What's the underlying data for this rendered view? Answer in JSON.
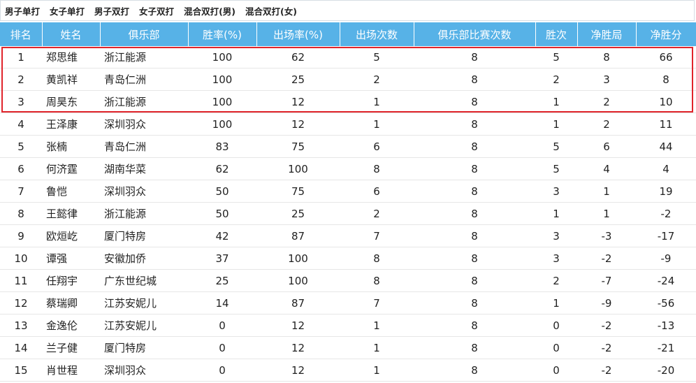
{
  "tabs": [
    "男子单打",
    "女子单打",
    "男子双打",
    "女子双打",
    "混合双打(男)",
    "混合双打(女)"
  ],
  "headers": [
    "排名",
    "姓名",
    "俱乐部",
    "胜率(%)",
    "出场率(%)",
    "出场次数",
    "俱乐部比赛次数",
    "胜次",
    "净胜局",
    "净胜分"
  ],
  "colors": {
    "header_bg": "#57b2e7",
    "highlight_border": "#e0242b"
  },
  "rows": [
    {
      "rank": "1",
      "name": "郑思维",
      "club": "浙江能源",
      "win_rate": "100",
      "appear_rate": "62",
      "appearances": "5",
      "club_matches": "8",
      "wins": "5",
      "net_games": "8",
      "net_points": "66"
    },
    {
      "rank": "2",
      "name": "黄凯祥",
      "club": "青岛仁洲",
      "win_rate": "100",
      "appear_rate": "25",
      "appearances": "2",
      "club_matches": "8",
      "wins": "2",
      "net_games": "3",
      "net_points": "8"
    },
    {
      "rank": "3",
      "name": "周昊东",
      "club": "浙江能源",
      "win_rate": "100",
      "appear_rate": "12",
      "appearances": "1",
      "club_matches": "8",
      "wins": "1",
      "net_games": "2",
      "net_points": "10"
    },
    {
      "rank": "4",
      "name": "王泽康",
      "club": "深圳羽众",
      "win_rate": "100",
      "appear_rate": "12",
      "appearances": "1",
      "club_matches": "8",
      "wins": "1",
      "net_games": "2",
      "net_points": "11"
    },
    {
      "rank": "5",
      "name": "张楠",
      "club": "青岛仁洲",
      "win_rate": "83",
      "appear_rate": "75",
      "appearances": "6",
      "club_matches": "8",
      "wins": "5",
      "net_games": "6",
      "net_points": "44"
    },
    {
      "rank": "6",
      "name": "何济霆",
      "club": "湖南华菜",
      "win_rate": "62",
      "appear_rate": "100",
      "appearances": "8",
      "club_matches": "8",
      "wins": "5",
      "net_games": "4",
      "net_points": "4"
    },
    {
      "rank": "7",
      "name": "鲁恺",
      "club": "深圳羽众",
      "win_rate": "50",
      "appear_rate": "75",
      "appearances": "6",
      "club_matches": "8",
      "wins": "3",
      "net_games": "1",
      "net_points": "19"
    },
    {
      "rank": "8",
      "name": "王懿律",
      "club": "浙江能源",
      "win_rate": "50",
      "appear_rate": "25",
      "appearances": "2",
      "club_matches": "8",
      "wins": "1",
      "net_games": "1",
      "net_points": "-2"
    },
    {
      "rank": "9",
      "name": "欧烜屹",
      "club": "厦门特房",
      "win_rate": "42",
      "appear_rate": "87",
      "appearances": "7",
      "club_matches": "8",
      "wins": "3",
      "net_games": "-3",
      "net_points": "-17"
    },
    {
      "rank": "10",
      "name": "谭强",
      "club": "安徽加侨",
      "win_rate": "37",
      "appear_rate": "100",
      "appearances": "8",
      "club_matches": "8",
      "wins": "3",
      "net_games": "-2",
      "net_points": "-9"
    },
    {
      "rank": "11",
      "name": "任翔宇",
      "club": "广东世纪城",
      "win_rate": "25",
      "appear_rate": "100",
      "appearances": "8",
      "club_matches": "8",
      "wins": "2",
      "net_games": "-7",
      "net_points": "-24"
    },
    {
      "rank": "12",
      "name": "蔡瑞卿",
      "club": "江苏安妮儿",
      "win_rate": "14",
      "appear_rate": "87",
      "appearances": "7",
      "club_matches": "8",
      "wins": "1",
      "net_games": "-9",
      "net_points": "-56"
    },
    {
      "rank": "13",
      "name": "金逸伦",
      "club": "江苏安妮儿",
      "win_rate": "0",
      "appear_rate": "12",
      "appearances": "1",
      "club_matches": "8",
      "wins": "0",
      "net_games": "-2",
      "net_points": "-13"
    },
    {
      "rank": "14",
      "name": "兰子健",
      "club": "厦门特房",
      "win_rate": "0",
      "appear_rate": "12",
      "appearances": "1",
      "club_matches": "8",
      "wins": "0",
      "net_games": "-2",
      "net_points": "-21"
    },
    {
      "rank": "15",
      "name": "肖世程",
      "club": "深圳羽众",
      "win_rate": "0",
      "appear_rate": "12",
      "appearances": "1",
      "club_matches": "8",
      "wins": "0",
      "net_games": "-2",
      "net_points": "-20"
    }
  ]
}
